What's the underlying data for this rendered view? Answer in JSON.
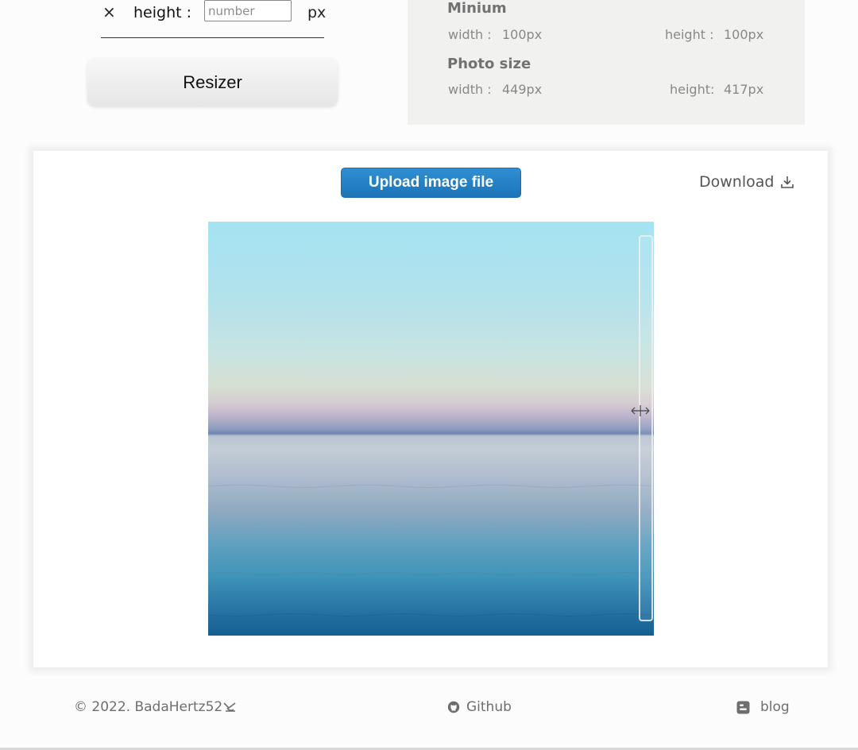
{
  "resize_form": {
    "times_symbol": "×",
    "height_label": "height :",
    "height_placeholder": "number",
    "height_value": "",
    "unit": "px",
    "resizer_label": "Resizer"
  },
  "info_panel": {
    "minimum_heading": "Minium",
    "minimum_width_label": "width :",
    "minimum_width_value": "100px",
    "minimum_height_label": "height :",
    "minimum_height_value": "100px",
    "photo_heading": "Photo size",
    "photo_width_label": "width :",
    "photo_width_value": "449px",
    "photo_height_label": "height:",
    "photo_height_value": "417px"
  },
  "card": {
    "upload_label": "Upload image file",
    "download_label": "Download"
  },
  "footer": {
    "copyright": "© 2022. BadaHertz52",
    "github_label": "Github",
    "blog_label": "blog"
  },
  "colors": {
    "upload_button": "#2580c3",
    "info_panel_bg": "#f1f1ef",
    "footer_text": "#6e6e6e"
  },
  "icons": {
    "close": "times-icon",
    "download": "download-icon",
    "github": "github-icon",
    "blog": "blogger-icon",
    "brand": "whale-icon",
    "cursor": "resize-cursor-icon"
  }
}
